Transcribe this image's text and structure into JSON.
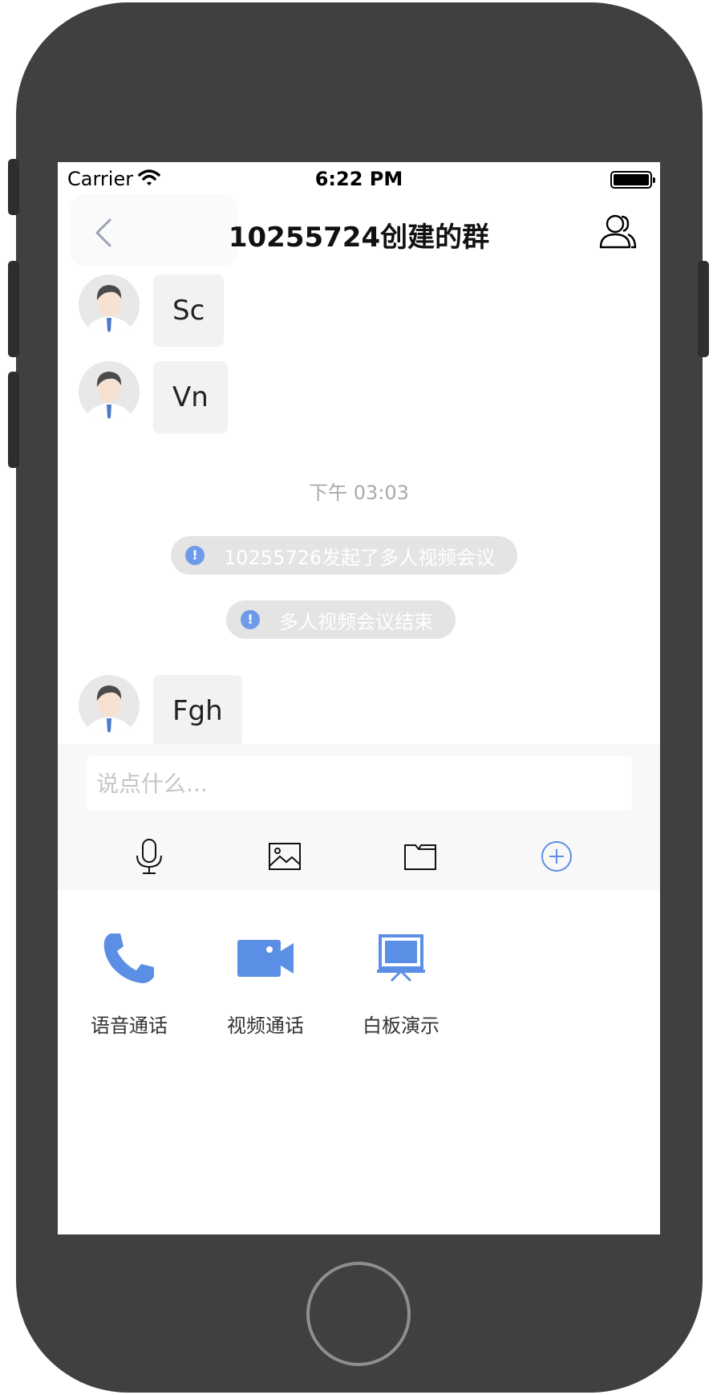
{
  "status_bar": {
    "carrier": "Carrier",
    "time": "6:22 PM"
  },
  "nav": {
    "title": "10255724创建的群",
    "back_icon": "chevron-left-icon",
    "members_icon": "group-members-icon"
  },
  "messages": [
    {
      "type": "text",
      "text": "Sc"
    },
    {
      "type": "text",
      "text": "Vn"
    },
    {
      "type": "text",
      "text": "Fgh"
    }
  ],
  "timestamp": "下午 03:03",
  "system_notices": [
    {
      "icon": "!",
      "text": "10255726发起了多人视频会议"
    },
    {
      "icon": "!",
      "text": "多人视频会议结束"
    }
  ],
  "input": {
    "placeholder": "说点什么..."
  },
  "toolbar": {
    "tools": [
      "microphone-icon",
      "image-icon",
      "folder-icon",
      "plus-circle-icon"
    ]
  },
  "actions": [
    {
      "label": "语音通话",
      "icon": "phone-icon"
    },
    {
      "label": "视频通话",
      "icon": "video-camera-icon"
    },
    {
      "label": "白板演示",
      "icon": "whiteboard-icon"
    }
  ],
  "colors": {
    "accent": "#5b8fe6",
    "frame": "#404040"
  }
}
